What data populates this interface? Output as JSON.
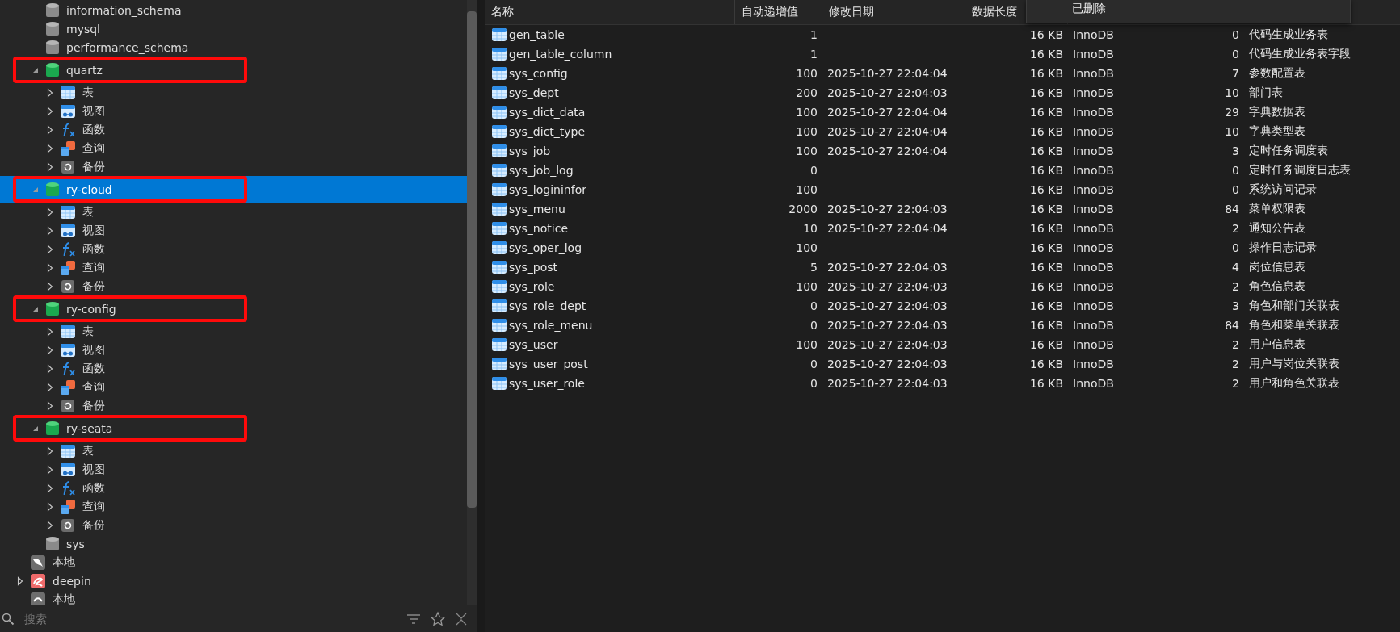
{
  "tree": {
    "databases": [
      {
        "label": "information_schema",
        "expanded": false,
        "selected": false,
        "highlighted": false
      },
      {
        "label": "mysql",
        "expanded": false,
        "selected": false,
        "highlighted": false
      },
      {
        "label": "performance_schema",
        "expanded": false,
        "selected": false,
        "highlighted": false
      },
      {
        "label": "quartz",
        "expanded": true,
        "selected": false,
        "highlighted": true,
        "children": [
          {
            "kind": "table",
            "label": "表",
            "expanded": false
          },
          {
            "kind": "view",
            "label": "视图",
            "expanded": false
          },
          {
            "kind": "function",
            "label": "函数",
            "expanded": false
          },
          {
            "kind": "query",
            "label": "查询",
            "expanded": false
          },
          {
            "kind": "backup",
            "label": "备份",
            "expanded": false
          }
        ]
      },
      {
        "label": "ry-cloud",
        "expanded": true,
        "selected": true,
        "highlighted": true,
        "children": [
          {
            "kind": "table",
            "label": "表",
            "expanded": false
          },
          {
            "kind": "view",
            "label": "视图",
            "expanded": false
          },
          {
            "kind": "function",
            "label": "函数",
            "expanded": false
          },
          {
            "kind": "query",
            "label": "查询",
            "expanded": false
          },
          {
            "kind": "backup",
            "label": "备份",
            "expanded": false
          }
        ]
      },
      {
        "label": "ry-config",
        "expanded": true,
        "selected": false,
        "highlighted": true,
        "children": [
          {
            "kind": "table",
            "label": "表",
            "expanded": false
          },
          {
            "kind": "view",
            "label": "视图",
            "expanded": false
          },
          {
            "kind": "function",
            "label": "函数",
            "expanded": false
          },
          {
            "kind": "query",
            "label": "查询",
            "expanded": false
          },
          {
            "kind": "backup",
            "label": "备份",
            "expanded": false
          }
        ]
      },
      {
        "label": "ry-seata",
        "expanded": true,
        "selected": false,
        "highlighted": true,
        "children": [
          {
            "kind": "table",
            "label": "表",
            "expanded": false
          },
          {
            "kind": "view",
            "label": "视图",
            "expanded": false
          },
          {
            "kind": "function",
            "label": "函数",
            "expanded": false
          },
          {
            "kind": "query",
            "label": "查询",
            "expanded": false
          },
          {
            "kind": "backup",
            "label": "备份",
            "expanded": false
          }
        ]
      },
      {
        "label": "sys",
        "expanded": false,
        "selected": false,
        "highlighted": false
      }
    ],
    "connections": [
      {
        "kind": "mysql",
        "label": "本地"
      },
      {
        "kind": "deepin",
        "label": "deepin",
        "expanded": false
      },
      {
        "kind": "other",
        "label": "本地"
      }
    ]
  },
  "search": {
    "placeholder": "搜索"
  },
  "table": {
    "columns": [
      "名称",
      "自动递增值",
      "修改日期",
      "数据长度"
    ],
    "rows": [
      [
        "gen_table",
        "1",
        "",
        "16 KB",
        "InnoDB",
        "0",
        "代码生成业务表"
      ],
      [
        "gen_table_column",
        "1",
        "",
        "16 KB",
        "InnoDB",
        "0",
        "代码生成业务表字段"
      ],
      [
        "sys_config",
        "100",
        "2025-10-27 22:04:04",
        "16 KB",
        "InnoDB",
        "7",
        "参数配置表"
      ],
      [
        "sys_dept",
        "200",
        "2025-10-27 22:04:03",
        "16 KB",
        "InnoDB",
        "10",
        "部门表"
      ],
      [
        "sys_dict_data",
        "100",
        "2025-10-27 22:04:04",
        "16 KB",
        "InnoDB",
        "29",
        "字典数据表"
      ],
      [
        "sys_dict_type",
        "100",
        "2025-10-27 22:04:04",
        "16 KB",
        "InnoDB",
        "10",
        "字典类型表"
      ],
      [
        "sys_job",
        "100",
        "2025-10-27 22:04:04",
        "16 KB",
        "InnoDB",
        "3",
        "定时任务调度表"
      ],
      [
        "sys_job_log",
        "0",
        "",
        "16 KB",
        "InnoDB",
        "0",
        "定时任务调度日志表"
      ],
      [
        "sys_logininfor",
        "100",
        "",
        "16 KB",
        "InnoDB",
        "0",
        "系统访问记录"
      ],
      [
        "sys_menu",
        "2000",
        "2025-10-27 22:04:03",
        "16 KB",
        "InnoDB",
        "84",
        "菜单权限表"
      ],
      [
        "sys_notice",
        "10",
        "2025-10-27 22:04:04",
        "16 KB",
        "InnoDB",
        "2",
        "通知公告表"
      ],
      [
        "sys_oper_log",
        "100",
        "",
        "16 KB",
        "InnoDB",
        "0",
        "操作日志记录"
      ],
      [
        "sys_post",
        "5",
        "2025-10-27 22:04:03",
        "16 KB",
        "InnoDB",
        "4",
        "岗位信息表"
      ],
      [
        "sys_role",
        "100",
        "2025-10-27 22:04:03",
        "16 KB",
        "InnoDB",
        "2",
        "角色信息表"
      ],
      [
        "sys_role_dept",
        "0",
        "2025-10-27 22:04:03",
        "16 KB",
        "InnoDB",
        "3",
        "角色和部门关联表"
      ],
      [
        "sys_role_menu",
        "0",
        "2025-10-27 22:04:03",
        "16 KB",
        "InnoDB",
        "84",
        "角色和菜单关联表"
      ],
      [
        "sys_user",
        "100",
        "2025-10-27 22:04:03",
        "16 KB",
        "InnoDB",
        "2",
        "用户信息表"
      ],
      [
        "sys_user_post",
        "0",
        "2025-10-27 22:04:03",
        "16 KB",
        "InnoDB",
        "2",
        "用户与岗位关联表"
      ],
      [
        "sys_user_role",
        "0",
        "2025-10-27 22:04:03",
        "16 KB",
        "InnoDB",
        "2",
        "用户和角色关联表"
      ]
    ]
  },
  "menu": {
    "items": [
      "已删除"
    ]
  }
}
